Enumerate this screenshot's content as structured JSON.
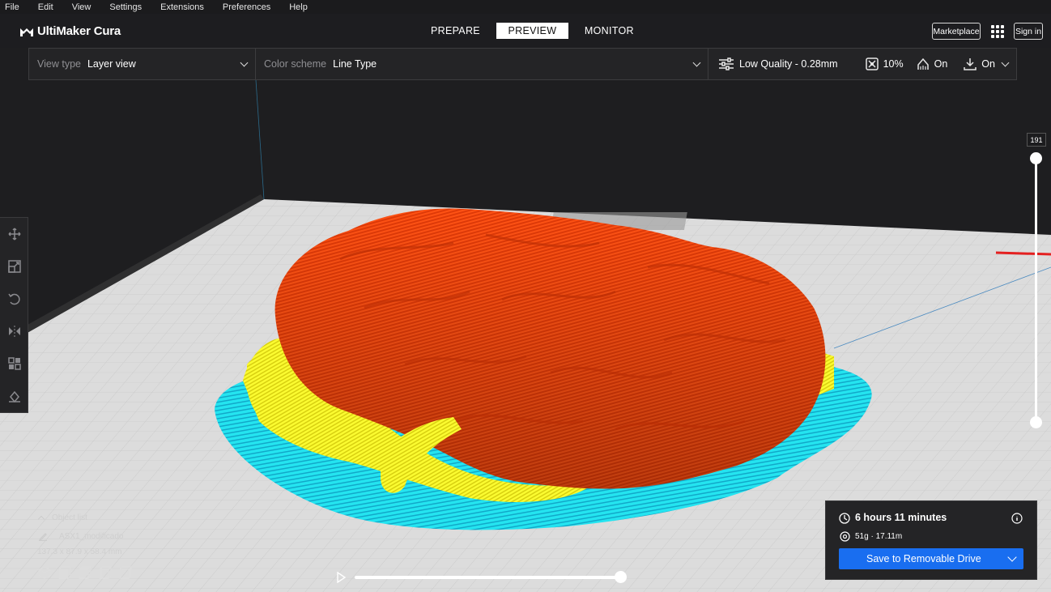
{
  "menu": [
    "File",
    "Edit",
    "View",
    "Settings",
    "Extensions",
    "Preferences",
    "Help"
  ],
  "header": {
    "app_name": "UltiMaker Cura",
    "stages": [
      {
        "label": "PREPARE",
        "active": false
      },
      {
        "label": "PREVIEW",
        "active": true
      },
      {
        "label": "MONITOR",
        "active": false
      }
    ],
    "marketplace_label": "Marketplace",
    "signin_label": "Sign in"
  },
  "view_toolbar": {
    "view_type_label": "View type",
    "view_type_value": "Layer view",
    "color_scheme_label": "Color scheme",
    "color_scheme_value": "Line Type",
    "profile": "Low Quality - 0.28mm",
    "infill": "10%",
    "support": "On",
    "adhesion": "On"
  },
  "layer_slider": {
    "current_layer": "191"
  },
  "object_list": {
    "header": "Object list",
    "object_name": "ASX1_modificado",
    "dimensions": "137.3 x 87.9 x 58.4 mm"
  },
  "print_info": {
    "time": "6 hours 11 minutes",
    "material": "51g · 17.11m",
    "save_label": "Save to Removable Drive"
  },
  "simulation": {
    "progress": 1.0
  },
  "colors": {
    "accent": "#196ef0",
    "wall_outer": "#ff4a12",
    "support": "#ffff2a",
    "skirt": "#1ee0ee",
    "infill": "#3a6ad8"
  }
}
